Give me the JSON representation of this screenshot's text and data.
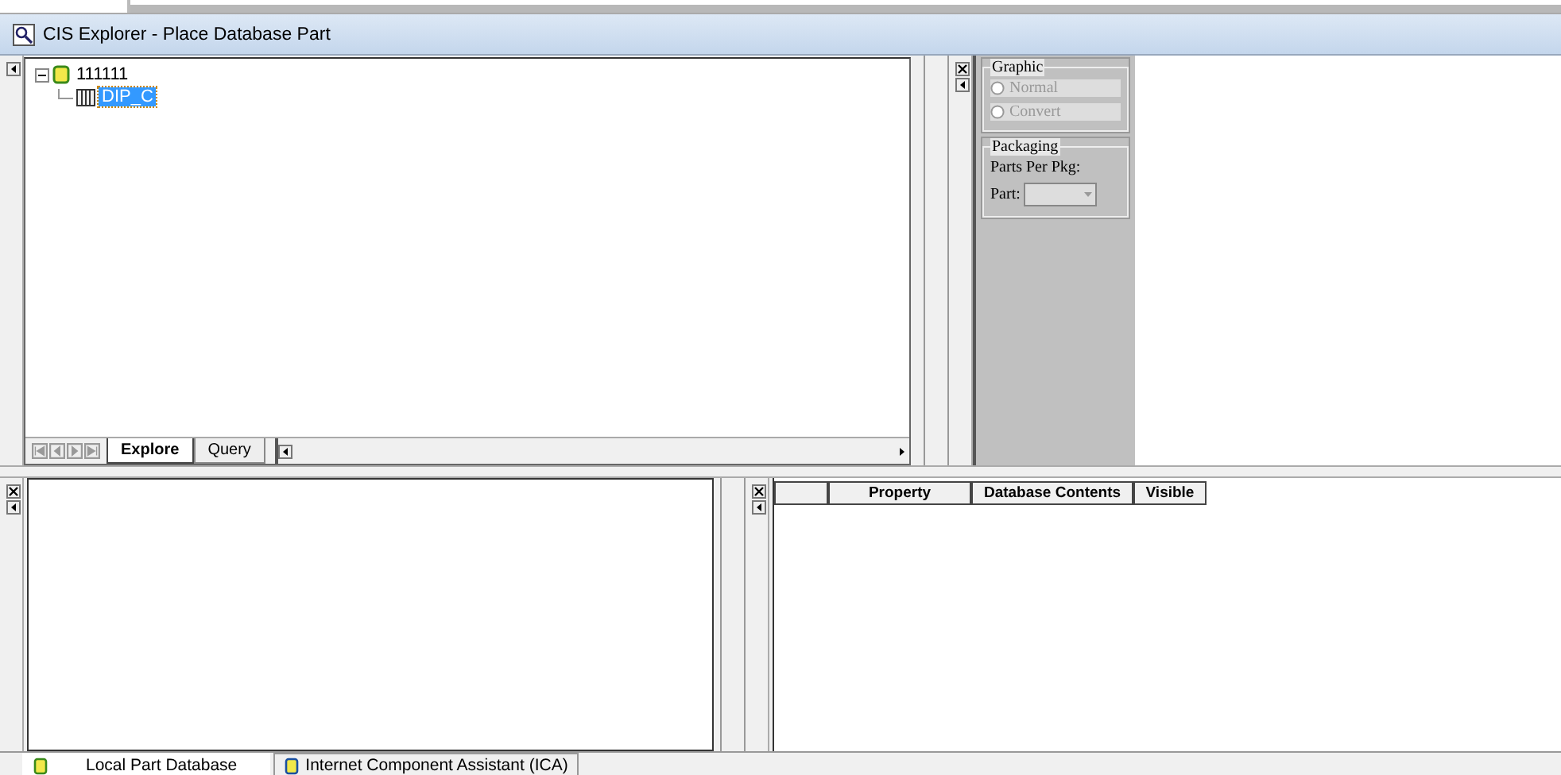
{
  "window": {
    "title": "CIS Explorer - Place Database Part"
  },
  "tree": [
    {
      "label": "111111",
      "expanded": true,
      "children": [
        {
          "label": "DIP_C",
          "selected": true
        }
      ]
    }
  ],
  "tree_tabs": [
    {
      "label": "Explore",
      "selected": true
    },
    {
      "label": "Query",
      "selected": false
    }
  ],
  "graphic": {
    "title": "Graphic",
    "options": [
      {
        "label": "Normal",
        "selected": false,
        "disabled": true
      },
      {
        "label": "Convert",
        "selected": false,
        "disabled": true
      }
    ]
  },
  "packaging": {
    "title": "Packaging",
    "parts_per_pkg_label": "Parts Per Pkg:",
    "part_label": "Part:"
  },
  "property_table": {
    "columns": [
      {
        "label": "Property"
      },
      {
        "label": "Database Contents"
      },
      {
        "label": "Visible"
      }
    ]
  },
  "bottom_tabs": [
    {
      "label": "Local Part Database",
      "selected": true
    },
    {
      "label": "Internet Component Assistant (ICA)",
      "selected": false
    }
  ]
}
